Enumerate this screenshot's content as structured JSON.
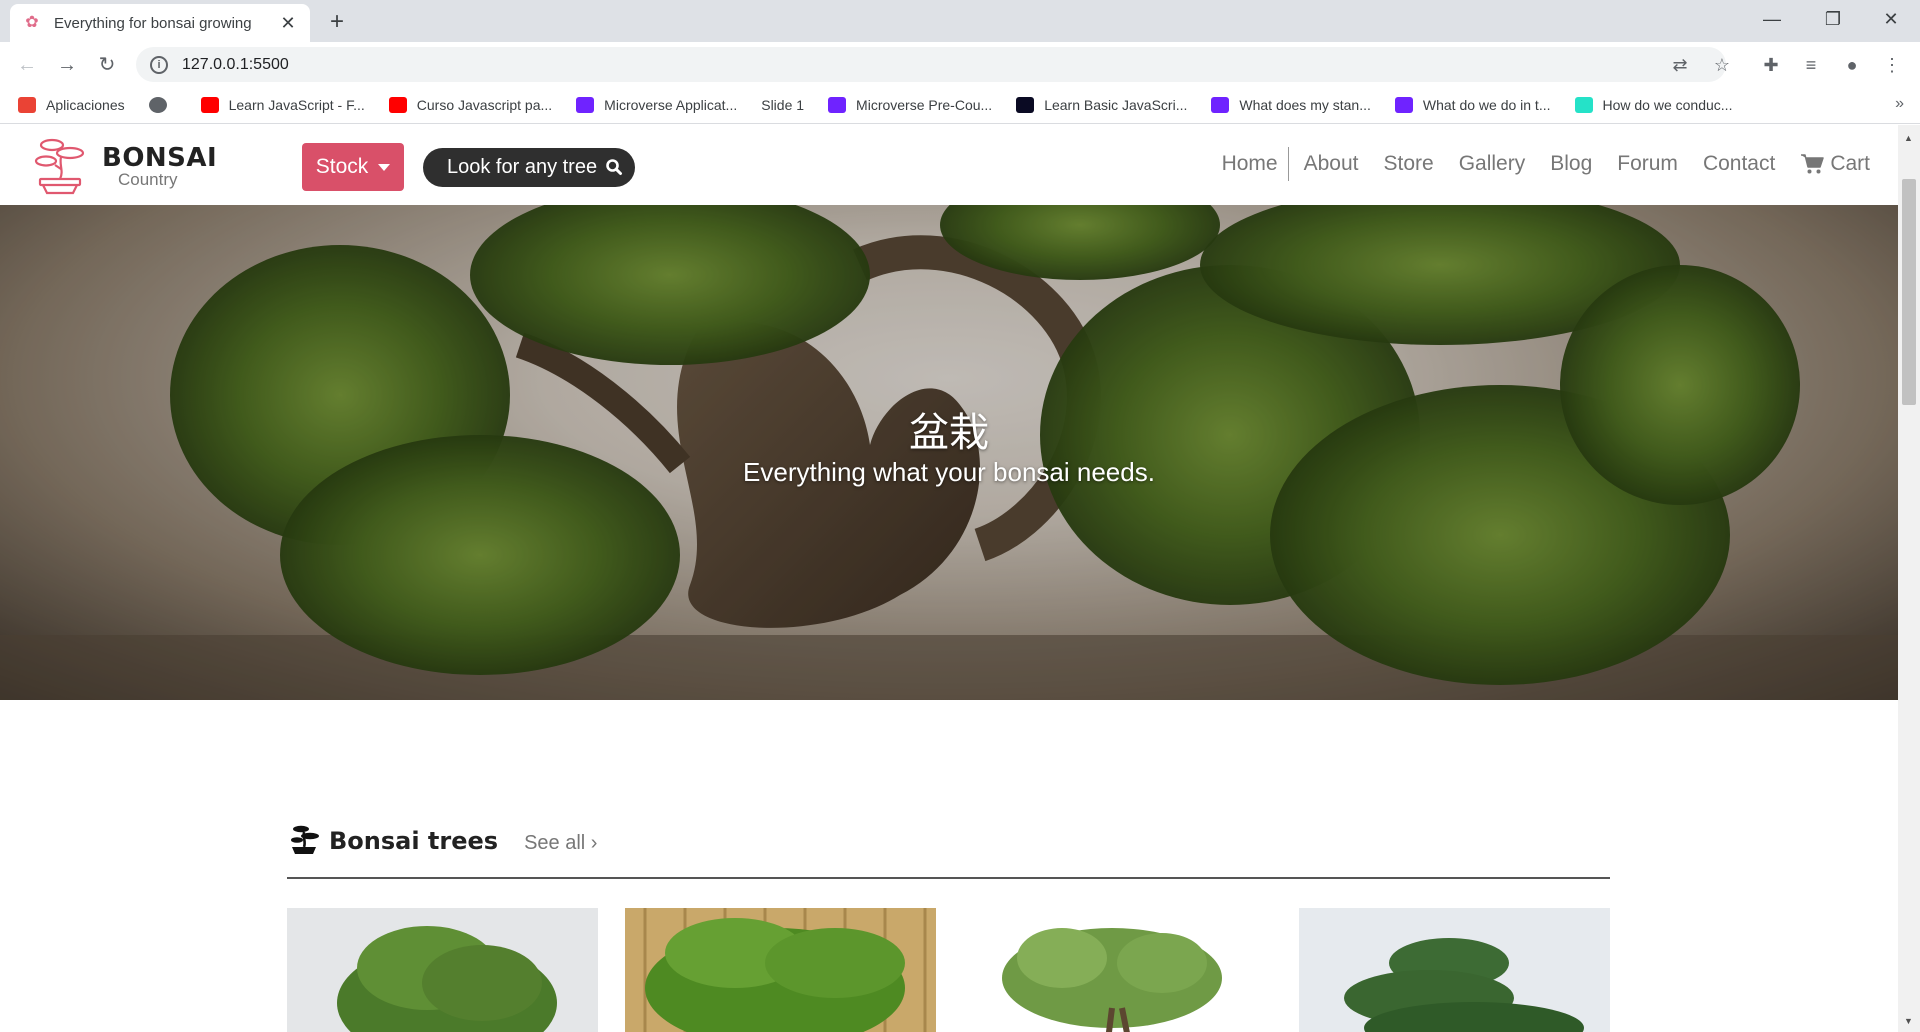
{
  "browser": {
    "tab_title": "Everything for bonsai growing",
    "tab_close": "✕",
    "new_tab": "+",
    "url": "127.0.0.1:5500",
    "window_controls": {
      "minimize": "—",
      "restore": "❐",
      "close": "✕"
    },
    "bookmarks": [
      {
        "label": "Aplicaciones",
        "icon": "apps-grid-icon",
        "color": "#ea4335"
      },
      {
        "label": "",
        "icon": "globe-icon",
        "color": "#5f6368"
      },
      {
        "label": "Learn JavaScript - F...",
        "icon": "youtube-icon",
        "color": "#ff0000"
      },
      {
        "label": "Curso Javascript pa...",
        "icon": "youtube-icon",
        "color": "#ff0000"
      },
      {
        "label": "Microverse Applicat...",
        "icon": "microverse-icon",
        "color": "#6f23ff"
      },
      {
        "label": "Slide 1",
        "icon": "",
        "color": ""
      },
      {
        "label": "Microverse Pre-Cou...",
        "icon": "microverse-icon",
        "color": "#6f23ff"
      },
      {
        "label": "Learn Basic JavaScri...",
        "icon": "fcc-icon",
        "color": "#0a0a23"
      },
      {
        "label": "What does my stan...",
        "icon": "microverse-icon",
        "color": "#6f23ff"
      },
      {
        "label": "What do we do in t...",
        "icon": "microverse-icon",
        "color": "#6f23ff"
      },
      {
        "label": "How do we conduc...",
        "icon": "m-icon",
        "color": "#25e2c8"
      }
    ],
    "bookmarks_more": "»"
  },
  "site": {
    "brand": "BONSAI",
    "brand_sub": "Country",
    "stock_label": "Stock",
    "search_label": "Look for any tree",
    "menu": [
      "Home",
      "About",
      "Store",
      "Gallery",
      "Blog",
      "Forum",
      "Contact"
    ],
    "cart_label": "Cart",
    "accent_color": "#d95069"
  },
  "hero": {
    "title": "盆栽",
    "subtitle": "Everything what your bonsai needs."
  },
  "section": {
    "title": "Bonsai trees",
    "see_all": "See all ›"
  }
}
